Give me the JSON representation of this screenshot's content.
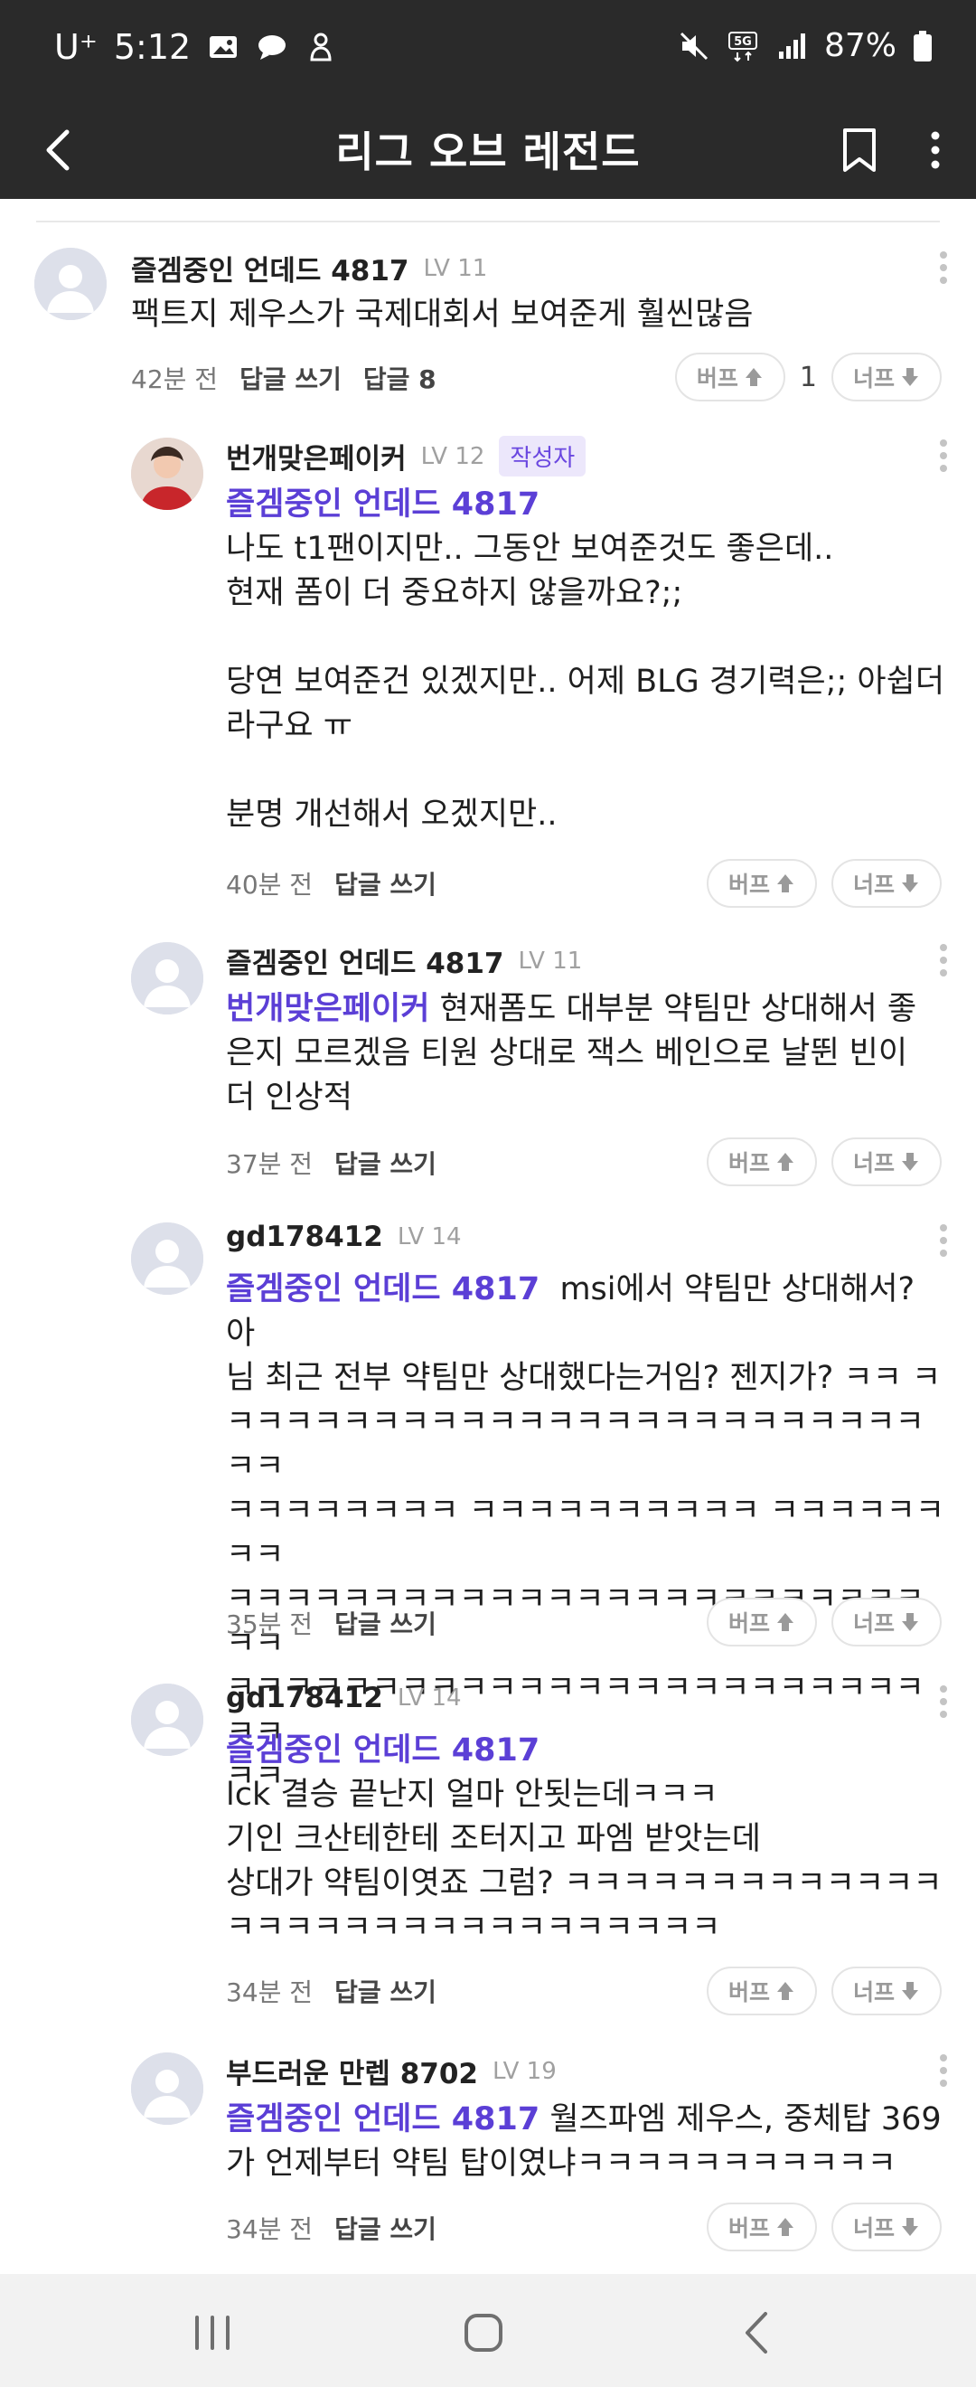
{
  "status_bar": {
    "carrier": "U⁺",
    "time": "5:12",
    "battery": "87%",
    "network": "5G"
  },
  "app_bar": {
    "title": "리그 오브 레전드"
  },
  "vote": {
    "up_label": "버프",
    "down_label": "너프"
  },
  "comments": [
    {
      "nick": "즐겜중인 언데드 4817",
      "level": "LV 11",
      "text": "팩트지 제우스가 국제대회서 보여준게 훨씬많음",
      "time": "42분 전",
      "reply_label": "답글 쓰기",
      "replies_label": "답글 8",
      "up_count": "1"
    },
    {
      "nick": "번개맞은페이커",
      "level": "LV 12",
      "badge": "작성자",
      "mention": "즐겜중인 언데드 4817",
      "text": "나도 t1팬이지만.. 그동안 보여준것도 좋은데..\n현재 폼이 더 중요하지 않을까요?;;\n\n당연 보여준건 있겠지만.. 어제 BLG 경기력은;; 아쉽더\n라구요 ㅠ\n\n분명 개선해서 오겠지만..",
      "time": "40분 전",
      "reply_label": "답글 쓰기"
    },
    {
      "nick": "즐겜중인 언데드 4817",
      "level": "LV 11",
      "mention": "번개맞은페이커",
      "text": " 현재폼도 대부분 약팀만 상대해서 좋\n은지 모르겠음 티원 상대로 잭스 베인으로 날뛴 빈이\n더 인상적",
      "time": "37분 전",
      "reply_label": "답글 쓰기"
    },
    {
      "nick": "gd178412",
      "level": "LV 14",
      "mention": "즐겜중인 언데드 4817",
      "text": "  msi에서 약팀만 상대해서? 아\n님 최근 전부 약팀만 상대했다는거임? 젠지가? ㅋㅋ ㅋ\nㅋㅋㅋㅋㅋㅋㅋㅋㅋㅋㅋㅋㅋㅋㅋㅋㅋㅋㅋㅋㅋㅋㅋㅋㅋㅋ\nㅋㅋㅋㅋㅋㅋㅋㅋ ㅋㅋㅋㅋㅋㅋㅋㅋㅋㅋ ㅋㅋㅋㅋㅋㅋㅋㅋ\nㅋㅋㅋㅋㅋㅋㅋㅋㅋㅋㅋㅋㅋㅋㅋㅋㅋㅋㅋㅋㅋㅋㅋㅋㅋㅋ\nㅋㅋㅋㅋㅋㅋㅋㅋㅋㅋㅋㅋㅋㅋㅋㅋㅋㅋㅋㅋㅋㅋㅋㅋㅋㅋ\nㅋㅋ",
      "time": "35분 전",
      "reply_label": "답글 쓰기"
    },
    {
      "nick": "gd178412",
      "level": "LV 14",
      "mention": "즐겜중인 언데드 4817",
      "text": "\nlck 결승 끝난지 얼마 안됫는데ㅋㅋㅋ\n기인 크산테한테 조터지고 파엠 받앗는데\n상대가 약팀이엿죠 그럼? ㅋㅋㅋㅋㅋㅋㅋㅋㅋㅋㅋㅋㅋ\nㅋㅋㅋㅋㅋㅋㅋㅋㅋㅋㅋㅋㅋㅋㅋㅋㅋ",
      "time": "34분 전",
      "reply_label": "답글 쓰기"
    },
    {
      "nick": "부드러운 만렙 8702",
      "level": "LV 19",
      "mention": "즐겜중인 언데드 4817",
      "text": " 월즈파엠 제우스, 중체탑 369\n가 언제부터 약팀 탑이였냐ㅋㅋㅋㅋㅋㅋㅋㅋㅋㅋㅋ",
      "time": "34분 전",
      "reply_label": "답글 쓰기"
    }
  ]
}
